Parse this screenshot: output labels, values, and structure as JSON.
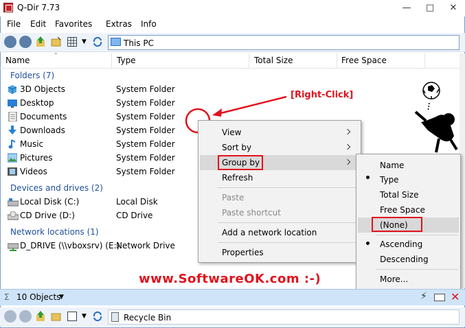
{
  "window": {
    "title": "Q-Dir 7.73"
  },
  "menubar": {
    "items": [
      "File",
      "Edit",
      "Favorites",
      "Extras",
      "Info"
    ]
  },
  "address": {
    "path": "This PC"
  },
  "columns": {
    "name": "Name",
    "type": "Type",
    "total_size": "Total Size",
    "free_space": "Free Space"
  },
  "groups": {
    "folders": {
      "label": "Folders (7)",
      "items": [
        {
          "name": "3D Objects",
          "type": "System Folder"
        },
        {
          "name": "Desktop",
          "type": "System Folder"
        },
        {
          "name": "Documents",
          "type": "System Folder"
        },
        {
          "name": "Downloads",
          "type": "System Folder"
        },
        {
          "name": "Music",
          "type": "System Folder"
        },
        {
          "name": "Pictures",
          "type": "System Folder"
        },
        {
          "name": "Videos",
          "type": "System Folder"
        }
      ]
    },
    "devices": {
      "label": "Devices and drives (2)",
      "items": [
        {
          "name": "Local Disk (C:)",
          "type": "Local Disk"
        },
        {
          "name": "CD Drive (D:)",
          "type": "CD Drive"
        }
      ]
    },
    "network": {
      "label": "Network locations (1)",
      "items": [
        {
          "name": "D_DRIVE (\\\\vboxsrv) (E:)",
          "type": "Network Drive"
        }
      ]
    }
  },
  "context_menu": {
    "view": "View",
    "sort_by": "Sort by",
    "group_by": "Group by",
    "refresh": "Refresh",
    "paste": "Paste",
    "paste_shortcut": "Paste shortcut",
    "add_network": "Add a network location",
    "properties": "Properties"
  },
  "submenu": {
    "name": "Name",
    "type": "Type",
    "total_size": "Total Size",
    "free_space": "Free Space",
    "none": "(None)",
    "ascending": "Ascending",
    "descending": "Descending",
    "more": "More..."
  },
  "annotations": {
    "right_click": "[Right-Click]",
    "watermark": "www.SoftwareOK.com :-)"
  },
  "status": {
    "objects": "10 Objects"
  },
  "address2": {
    "path": "Recycle Bin"
  },
  "colors": {
    "accent": "#1e4e9a",
    "annotation_red": "#e0121c",
    "statusbar": "#cfe4f8"
  }
}
